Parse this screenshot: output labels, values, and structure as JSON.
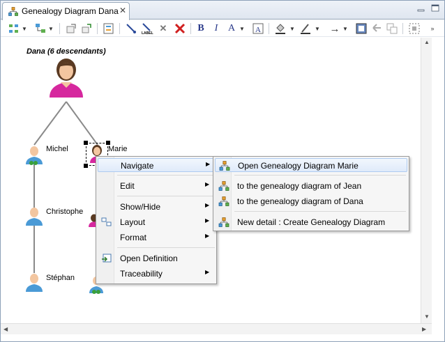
{
  "tab": {
    "title": "Genealogy Diagram Dana",
    "close": "✕"
  },
  "toolbar": {
    "bold": "B",
    "italic": "I",
    "font_color": "A",
    "arrow": "→"
  },
  "diagram": {
    "root_label": "Dana (6 descendants)",
    "nodes": {
      "michel": "Michel",
      "marie": "Marie",
      "christophe": "Christophe",
      "stephan": "Stéphan"
    }
  },
  "context_menu": {
    "items": [
      {
        "label": "Navigate"
      },
      {
        "label": "Edit"
      },
      {
        "label": "Show/Hide"
      },
      {
        "label": "Layout"
      },
      {
        "label": "Format"
      },
      {
        "label": "Open Definition"
      },
      {
        "label": "Traceability"
      }
    ]
  },
  "submenu": {
    "items": [
      {
        "label": "Open Genealogy Diagram Marie"
      },
      {
        "label": "to the genealogy diagram of Jean"
      },
      {
        "label": "to the genealogy diagram of Dana"
      },
      {
        "label": "New detail : Create Genealogy Diagram"
      }
    ]
  },
  "colors": {
    "female": "#d6289e",
    "male": "#4a9ad6",
    "skin": "#f3c6a0",
    "hair": "#5a3a22",
    "connector": "#8a8a8a"
  }
}
